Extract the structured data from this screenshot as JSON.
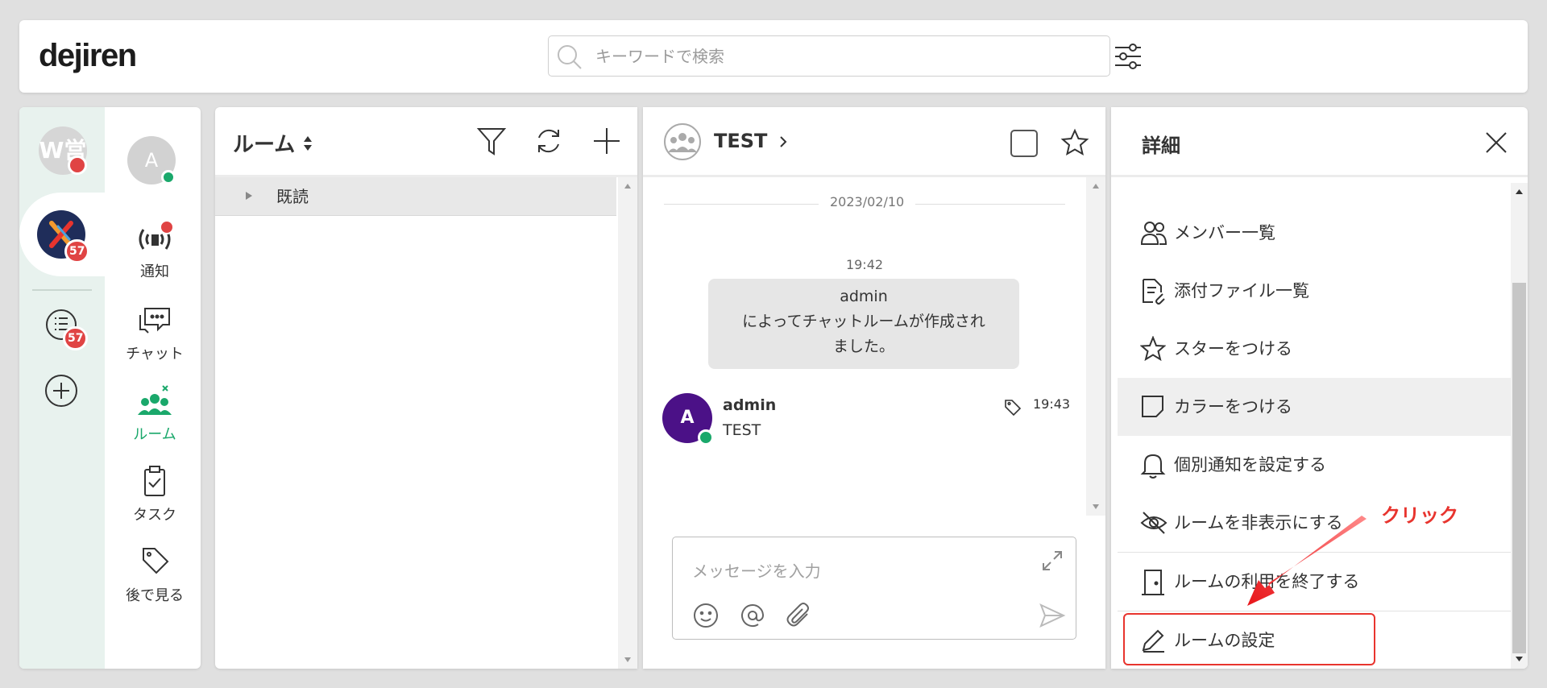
{
  "header": {
    "logo": "dejiren",
    "search_placeholder": "キーワードで検索"
  },
  "rail": {
    "workspace_w_label": "W営",
    "workspace_active_badge": "57",
    "threads_badge": "57",
    "user_initial": "A",
    "nav": {
      "notify": "通知",
      "chat": "チャット",
      "room": "ルーム",
      "task": "タスク",
      "later": "後で見る"
    }
  },
  "roomlist": {
    "title": "ルーム",
    "group_label": "既読"
  },
  "chat": {
    "title": "TEST",
    "date": "2023/02/10",
    "system": {
      "time": "19:42",
      "line1": "admin",
      "line2": "によってチャットルームが作成され",
      "line3": "ました。"
    },
    "message": {
      "avatar_initial": "A",
      "author": "admin",
      "text": "TEST",
      "time": "19:43"
    },
    "composer_placeholder": "メッセージを入力"
  },
  "details": {
    "title": "詳細",
    "items": [
      {
        "label": "メンバー一覧"
      },
      {
        "label": "添付ファイル一覧"
      },
      {
        "label": "スターをつける"
      },
      {
        "label": "カラーをつける"
      },
      {
        "label": "個別通知を設定する"
      },
      {
        "label": "ルームを非表示にする"
      },
      {
        "label": "ルームの利用を終了する"
      },
      {
        "label": "ルームの設定"
      }
    ]
  },
  "annotation": {
    "label": "クリック",
    "color": "#e8342e"
  },
  "colors": {
    "accent_green": "#1aa86b",
    "badge_red": "#e04444",
    "avatar_purple": "#4b1187"
  }
}
